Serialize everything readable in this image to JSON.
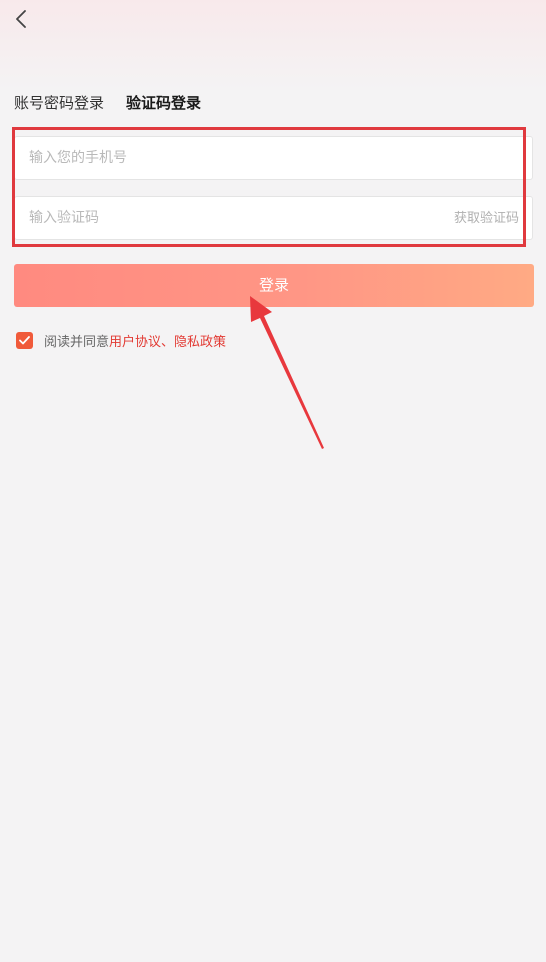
{
  "tabs": {
    "password_login": "账号密码登录",
    "code_login": "验证码登录"
  },
  "form": {
    "phone_placeholder": "输入您的手机号",
    "code_placeholder": "输入验证码",
    "get_code_label": "获取验证码",
    "login_label": "登录"
  },
  "agreement": {
    "prefix": "阅读并同意",
    "user_agreement": "用户协议",
    "separator": "、",
    "privacy_policy": "隐私政策",
    "checked": true
  },
  "colors": {
    "accent_red": "#e23a33",
    "checkbox": "#f05a3a",
    "annotation": "#e0393e"
  },
  "icons": {
    "back": "chevron-left-icon",
    "check": "check-icon"
  }
}
